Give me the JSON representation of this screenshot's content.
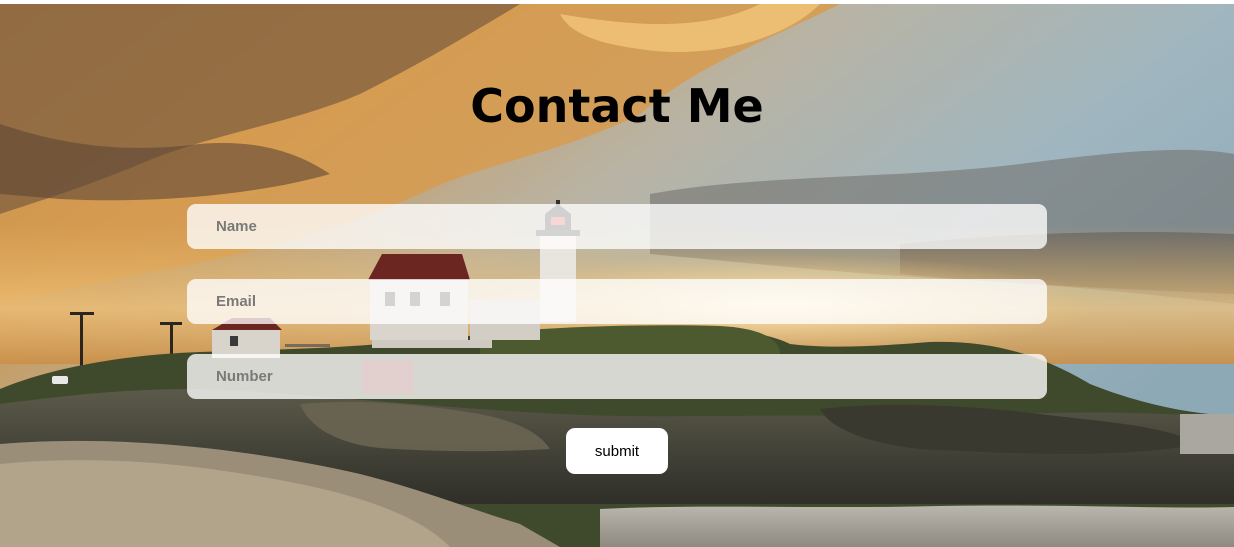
{
  "page": {
    "title": "Contact Me"
  },
  "form": {
    "name": {
      "placeholder": "Name",
      "value": ""
    },
    "email": {
      "placeholder": "Email",
      "value": ""
    },
    "number": {
      "placeholder": "Number",
      "value": ""
    },
    "submit_label": "submit"
  },
  "background": {
    "description_icon": "lighthouse-sunset-image",
    "colors": {
      "sky_blue": "#9db7c3",
      "sunset_gold": "#e8a84a",
      "cloud_dark": "#5a4a40",
      "rocks": "#4b4a3f",
      "water": "#a9a7a0"
    }
  }
}
